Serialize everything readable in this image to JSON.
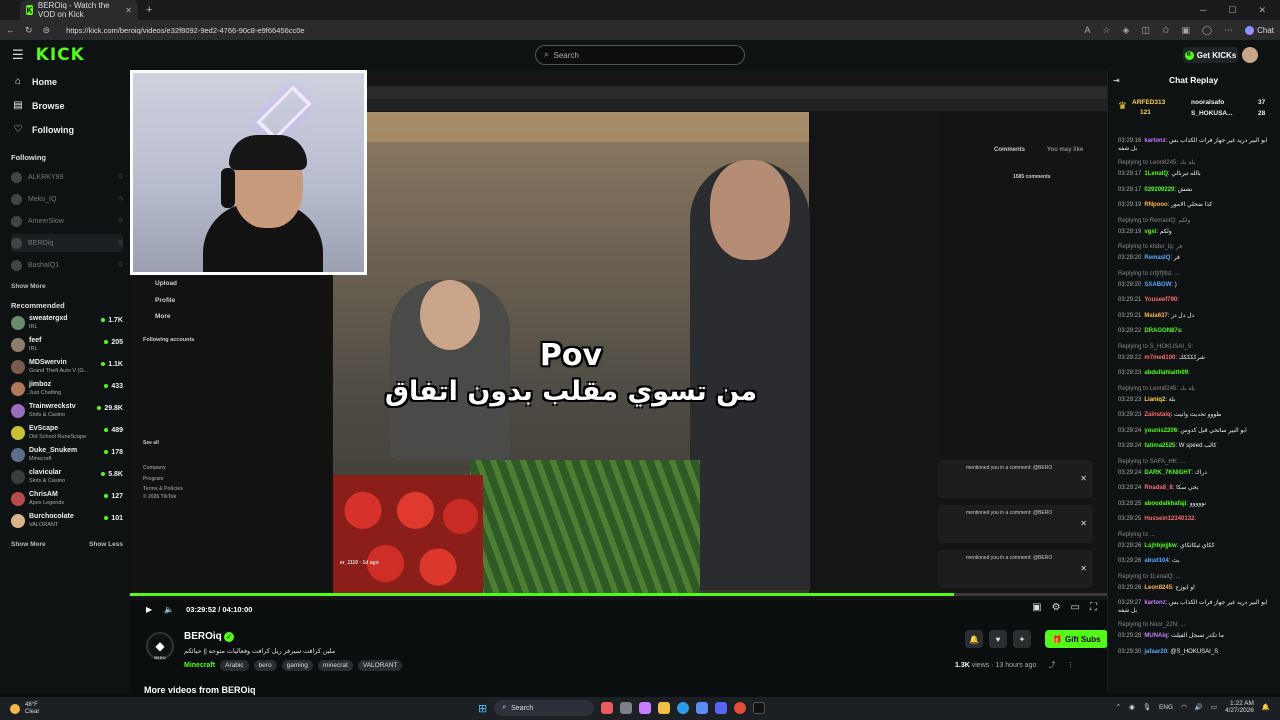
{
  "browser": {
    "tab_title": "BEROiq - Watch the VOD on Kick",
    "url": "https://kick.com/beroiq/videos/e32f8092-9ed2-4766-90c8-e9f66456cc0e",
    "chat_label": "Chat"
  },
  "header": {
    "logo": "KICK",
    "search_placeholder": "Search",
    "get_kicks": "Get KICKs"
  },
  "sidebar": {
    "nav": [
      {
        "label": "Home",
        "icon": "home-icon"
      },
      {
        "label": "Browse",
        "icon": "browse-icon"
      },
      {
        "label": "Following",
        "icon": "heart-icon"
      }
    ],
    "following_title": "Following",
    "following": [
      "ALKRKY99",
      "Meko_IQ",
      "AmeerSlow",
      "BEROiq",
      "BashaIQ1"
    ],
    "show_more_following": "Show More",
    "recommended_title": "Recommended",
    "recommended": [
      {
        "name": "sweatergxd",
        "category": "IRL",
        "viewers": "1.7K",
        "color": "#6c8a6e"
      },
      {
        "name": "feef",
        "category": "IRL",
        "viewers": "205",
        "color": "#8d7f6b"
      },
      {
        "name": "MDSwervin",
        "category": "Grand Theft Auto V (G...",
        "viewers": "1.1K",
        "color": "#7a5a4a"
      },
      {
        "name": "jimboz",
        "category": "Just Chatting",
        "viewers": "433",
        "color": "#b07a5a"
      },
      {
        "name": "Trainwreckstv",
        "category": "Slots & Casino",
        "viewers": "29.8K",
        "color": "#9a6cc2"
      },
      {
        "name": "EvScape",
        "category": "Old School RuneScape",
        "viewers": "489",
        "color": "#c9c136"
      },
      {
        "name": "Duke_Snukem",
        "category": "Minecraft",
        "viewers": "178",
        "color": "#5a6d8a"
      },
      {
        "name": "clavicular",
        "category": "Slots & Casino",
        "viewers": "5.8K",
        "color": "#3a3d3f"
      },
      {
        "name": "ChrisAM",
        "category": "Apex Legends",
        "viewers": "127",
        "color": "#b84a4a"
      },
      {
        "name": "Burchocolate",
        "category": "VALORANT",
        "viewers": "101",
        "color": "#d7b48a"
      }
    ],
    "show_more": "Show More",
    "show_less": "Show Less"
  },
  "video": {
    "caption_line1": "Pov",
    "caption_line2": "من تسوي مقلب بدون اتفاق",
    "tiktok_left": [
      "Upload",
      "Profile",
      "More",
      "Following accounts",
      "See all",
      "Company",
      "Program",
      "Terms & Policies",
      "© 2026 TikTok"
    ],
    "tiktok_user": "er_1110 · 1d ago",
    "tiktok_tabs": [
      "Comments",
      "You may like"
    ],
    "comments_count": "1585 comments",
    "notif_text": "mentioned you in a comment: @BERO",
    "current_time": "03:29:52",
    "duration": "04:10:00",
    "progress": 0.843
  },
  "channel": {
    "name": "BEROiq",
    "avatar_label": "BERO",
    "title": "ملين كرافت سيرفر ريل كرافت وفعاليات متوحه || حيائكم",
    "category": "Minecraft",
    "tags": [
      "Arabic",
      "bero",
      "gaming",
      "minecrat",
      "VALORANT"
    ],
    "views": "1.3K",
    "views_label": "views",
    "age": "13 hours ago",
    "gift_subs": "Gift Subs",
    "more_videos": "More videos from BEROiq"
  },
  "chat": {
    "title": "Chat Replay",
    "leaderboard": [
      {
        "name": "ARFED313",
        "value": "121"
      },
      {
        "name": "nooralsafo",
        "value": "37"
      },
      {
        "name": "S_HOKUSA...",
        "value": "28"
      }
    ],
    "messages": [
      {
        "time": "03:29:16",
        "user": "kartonz",
        "color": "#c77dff",
        "text": "ابو البير دريد غير جهاز فرات الكذاب بس بل شفه",
        "reply": ""
      },
      {
        "time": "",
        "user": "",
        "color": "",
        "text": "",
        "reply": "Replying to Leon8245: بلة بك"
      },
      {
        "time": "03:29:17",
        "user": "1LenalQ",
        "color": "#53fc18",
        "text": "بالله تبرنالي",
        "reply": ""
      },
      {
        "time": "03:29:17",
        "user": "029209229",
        "color": "#53fc18",
        "text": "نشش",
        "reply": ""
      },
      {
        "time": "03:29:19",
        "user": "RNpooo",
        "color": "#ffb347",
        "text": "كذا ضحلي الامور",
        "reply": ""
      },
      {
        "time": "",
        "user": "",
        "color": "",
        "text": "",
        "reply": "Replying to RemasIQ: ولكم"
      },
      {
        "time": "03:29:19",
        "user": "vgxi",
        "color": "#53fc18",
        "text": "ولكم",
        "reply": ""
      },
      {
        "time": "",
        "user": "",
        "color": "",
        "text": "",
        "reply": "Replying to khder_lq: فر"
      },
      {
        "time": "03:29:20",
        "user": "RemasIQ",
        "color": "#58a6ff",
        "text": "فر",
        "reply": ""
      },
      {
        "time": "",
        "user": "",
        "color": "",
        "text": "",
        "reply": "Replying to crt[rf]ltst: ..."
      },
      {
        "time": "03:29:20",
        "user": "SXABOW",
        "color": "#58a6ff",
        "text": ")",
        "reply": ""
      },
      {
        "time": "03:29:21",
        "user": "Youseef790",
        "color": "#ff6b6b",
        "text": "",
        "reply": ""
      },
      {
        "time": "03:29:21",
        "user": "Mala637",
        "color": "#ffb347",
        "text": "دل دل دز",
        "reply": ""
      },
      {
        "time": "03:29:22",
        "user": "DRAGON87s",
        "color": "#53fc18",
        "text": "",
        "reply": ""
      },
      {
        "time": "",
        "user": "",
        "color": "",
        "text": "",
        "reply": "Replying to S_HOKUSAI_S: "
      },
      {
        "time": "03:29:22",
        "user": "m7med100",
        "color": "#ff6b6b",
        "text": "شرككككك",
        "reply": ""
      },
      {
        "time": "03:29:23",
        "user": "abdullahlaith99",
        "color": "#53fc18",
        "text": "",
        "reply": ""
      },
      {
        "time": "",
        "user": "",
        "color": "",
        "text": "",
        "reply": "Replying to Leon8245: بلة بك"
      },
      {
        "time": "03:29:23",
        "user": "Lianiq2",
        "color": "#ffd24a",
        "text": "بلة",
        "reply": ""
      },
      {
        "time": "03:29:23",
        "user": "Zainstaiq",
        "color": "#ff6b6b",
        "text": "طووو تحديث وانيت",
        "reply": ""
      },
      {
        "time": "03:29:24",
        "user": "younis2206",
        "color": "#53fc18",
        "text": "ابو البير ساتحي قبل كدوس",
        "reply": ""
      },
      {
        "time": "03:29:24",
        "user": "fatima2525",
        "color": "#53fc18",
        "text": "W speed كالب",
        "reply": ""
      },
      {
        "time": "",
        "user": "",
        "color": "",
        "text": "",
        "reply": "Replying to SAFA_HK: ..."
      },
      {
        "time": "03:29:24",
        "user": "DARK_7KNIGHT",
        "color": "#53fc18",
        "text": "دراك",
        "reply": ""
      },
      {
        "time": "03:29:24",
        "user": "Rnada8_8",
        "color": "#ff6b6b",
        "text": "يحي سكا",
        "reply": ""
      },
      {
        "time": "03:29:25",
        "user": "aboodalkhafaji",
        "color": "#53fc18",
        "text": "نووووو",
        "reply": ""
      },
      {
        "time": "03:29:25",
        "user": "Hussein12340132",
        "color": "#ff6b6b",
        "text": "",
        "reply": ""
      },
      {
        "time": "",
        "user": "",
        "color": "",
        "text": "",
        "reply": "Replying to ..."
      },
      {
        "time": "03:29:26",
        "user": "Lsjhhjejjkw",
        "color": "#53fc18",
        "text": "ككاي ثيكاثكاي",
        "reply": ""
      },
      {
        "time": "03:29:26",
        "user": "abud104",
        "color": "#58a6ff",
        "text": "بث",
        "reply": ""
      },
      {
        "time": "",
        "user": "",
        "color": "",
        "text": "",
        "reply": "Replying to 1LenalQ: ..."
      },
      {
        "time": "03:29:26",
        "user": "Leon8245",
        "color": "#ffb347",
        "text": "او ابوزح",
        "reply": ""
      },
      {
        "time": "03:29:27",
        "user": "kartonz",
        "color": "#c77dff",
        "text": "ابو البير دريد غير جهاز فرات الكذاب بس بل شفه",
        "reply": ""
      },
      {
        "time": "",
        "user": "",
        "color": "",
        "text": "",
        "reply": "Replying to Noor_22N: ..."
      },
      {
        "time": "03:29:28",
        "user": "MUNAiq",
        "color": "#c77dff",
        "text": "ما تكدر تسجل الفيلت",
        "reply": ""
      },
      {
        "time": "03:29:30",
        "user": "jafaar20",
        "color": "#58a6ff",
        "text": "@S_HOKUSAI_S",
        "reply": ""
      }
    ]
  },
  "taskbar": {
    "temp": "48°F",
    "condition": "Clear",
    "search": "Search",
    "lang": "ENG",
    "time": "1:22 AM",
    "date": "4/27/2026"
  }
}
